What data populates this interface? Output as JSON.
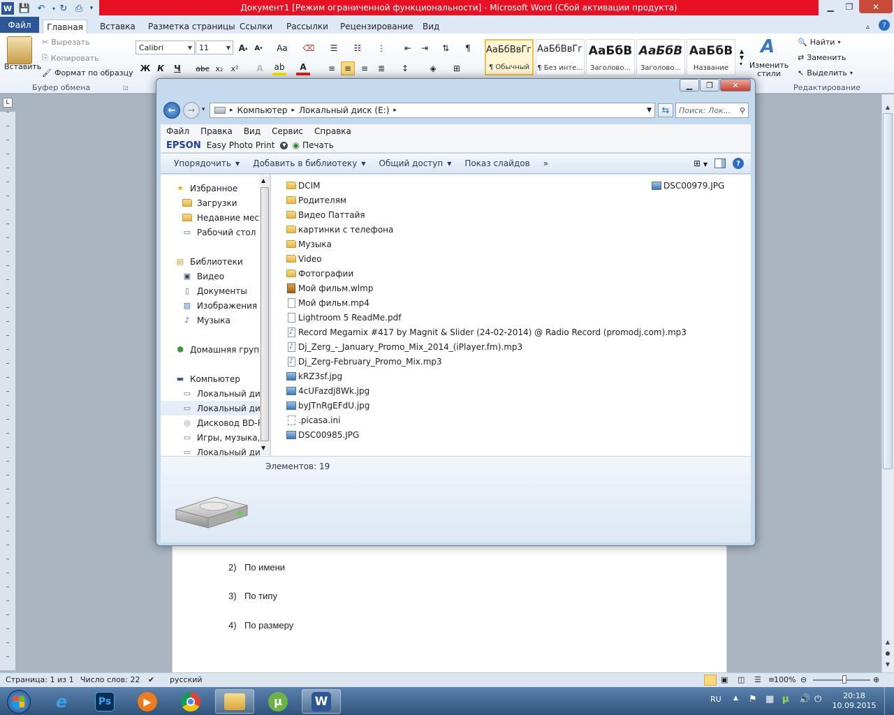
{
  "word": {
    "title": "Документ1 [Режим ограниченной функциональности]  -  Microsoft Word (Сбой активации продукта)",
    "tabs": [
      "Файл",
      "Главная",
      "Вставка",
      "Разметка страницы",
      "Ссылки",
      "Рассылки",
      "Рецензирование",
      "Вид"
    ],
    "clipboard": {
      "paste": "Вставить",
      "cut": "Вырезать",
      "copy": "Копировать",
      "format_painter": "Формат по образцу",
      "group": "Буфер обмена"
    },
    "font": {
      "name": "Calibri",
      "size": "11"
    },
    "styles": [
      {
        "preview": "АаБбВвГг,",
        "name": "¶ Обычный"
      },
      {
        "preview": "АаБбВвГг,",
        "name": "¶ Без инте..."
      },
      {
        "preview": "АаБбВ",
        "name": "Заголово..."
      },
      {
        "preview": "АаБбВ",
        "name": "Заголово..."
      },
      {
        "preview": "АаБбВ",
        "name": "Название"
      }
    ],
    "change_styles": "Изменить стили",
    "editing": {
      "find": "Найти",
      "replace": "Заменить",
      "select": "Выделить",
      "group": "Редактирование"
    },
    "list_items": [
      {
        "num": "2)",
        "text": "По имени"
      },
      {
        "num": "3)",
        "text": "По типу"
      },
      {
        "num": "4)",
        "text": "По размеру"
      }
    ],
    "status": {
      "page": "Страница: 1 из 1",
      "words": "Число слов: 22",
      "lang": "русский",
      "zoom": "100%"
    }
  },
  "explorer": {
    "address": [
      "Компьютер",
      "Локальный диск (E:)"
    ],
    "search_placeholder": "Поиск: Лок...",
    "menu": [
      "Файл",
      "Правка",
      "Вид",
      "Сервис",
      "Справка"
    ],
    "epson": {
      "brand": "EPSON",
      "app": "Easy Photo Print",
      "print": "Печать"
    },
    "commands": [
      "Упорядочить",
      "Добавить в библиотеку",
      "Общий доступ",
      "Показ слайдов"
    ],
    "more": "»",
    "nav": [
      {
        "label": "Избранное",
        "icon": "star",
        "indent": 0
      },
      {
        "label": "Загрузки",
        "icon": "folder",
        "indent": 1
      },
      {
        "label": "Недавние места",
        "icon": "folder",
        "indent": 1
      },
      {
        "label": "Рабочий стол",
        "icon": "desktop",
        "indent": 1
      },
      {
        "label": "",
        "icon": "",
        "indent": 0
      },
      {
        "label": "Библиотеки",
        "icon": "library",
        "indent": 0
      },
      {
        "label": "Видео",
        "icon": "video",
        "indent": 1
      },
      {
        "label": "Документы",
        "icon": "doc",
        "indent": 1
      },
      {
        "label": "Изображения",
        "icon": "image",
        "indent": 1
      },
      {
        "label": "Музыка",
        "icon": "music",
        "indent": 1
      },
      {
        "label": "",
        "icon": "",
        "indent": 0
      },
      {
        "label": "Домашняя группа",
        "icon": "homegroup",
        "indent": 0
      },
      {
        "label": "",
        "icon": "",
        "indent": 0
      },
      {
        "label": "Компьютер",
        "icon": "computer",
        "indent": 0
      },
      {
        "label": "Локальный диск",
        "icon": "drive",
        "indent": 1
      },
      {
        "label": "Локальный диск",
        "icon": "drive",
        "indent": 1,
        "selected": true
      },
      {
        "label": "Дисковод BD-RO",
        "icon": "disc",
        "indent": 1
      },
      {
        "label": "Игры, музыка, в",
        "icon": "drive",
        "indent": 1
      },
      {
        "label": "Локальный диск",
        "icon": "drive",
        "indent": 1
      }
    ],
    "files": [
      {
        "name": "DCIM",
        "type": "folder"
      },
      {
        "name": "Родителям",
        "type": "folder"
      },
      {
        "name": "Видео Паттайя",
        "type": "folder"
      },
      {
        "name": "картинки с  телефона",
        "type": "folder"
      },
      {
        "name": "Музыка",
        "type": "folder"
      },
      {
        "name": "Video",
        "type": "folder"
      },
      {
        "name": "Фотографии",
        "type": "folder"
      },
      {
        "name": "Мой фильм.wlmp",
        "type": "video"
      },
      {
        "name": "Мой фильм.mp4",
        "type": "file"
      },
      {
        "name": "Lightroom 5 ReadMe.pdf",
        "type": "file"
      },
      {
        "name": "Record Megamix #417 by Magnit & Slider (24-02-2014) @ Radio Record (promodj.com).mp3",
        "type": "audio"
      },
      {
        "name": "Dj_Zerg_-_January_Promo_Mix_2014_(iPlayer.fm).mp3",
        "type": "audio"
      },
      {
        "name": "Dj_Zerg-February_Promo_Mix.mp3",
        "type": "audio"
      },
      {
        "name": "kRZ3sf.jpg",
        "type": "image"
      },
      {
        "name": "4cUFazdj8Wk.jpg",
        "type": "image"
      },
      {
        "name": "byJTnRgEFdU.jpg",
        "type": "image"
      },
      {
        "name": ".picasa.ini",
        "type": "ini"
      },
      {
        "name": "DSC00985.JPG",
        "type": "image"
      }
    ],
    "files_col2": [
      {
        "name": "DSC00979.JPG",
        "type": "image"
      }
    ],
    "item_count": "Элементов: 19"
  },
  "taskbar": {
    "lang": "RU",
    "time": "20:18",
    "date": "10.09.2015"
  },
  "colors": {
    "accent": "#2b5797",
    "title_red": "#e81123"
  }
}
